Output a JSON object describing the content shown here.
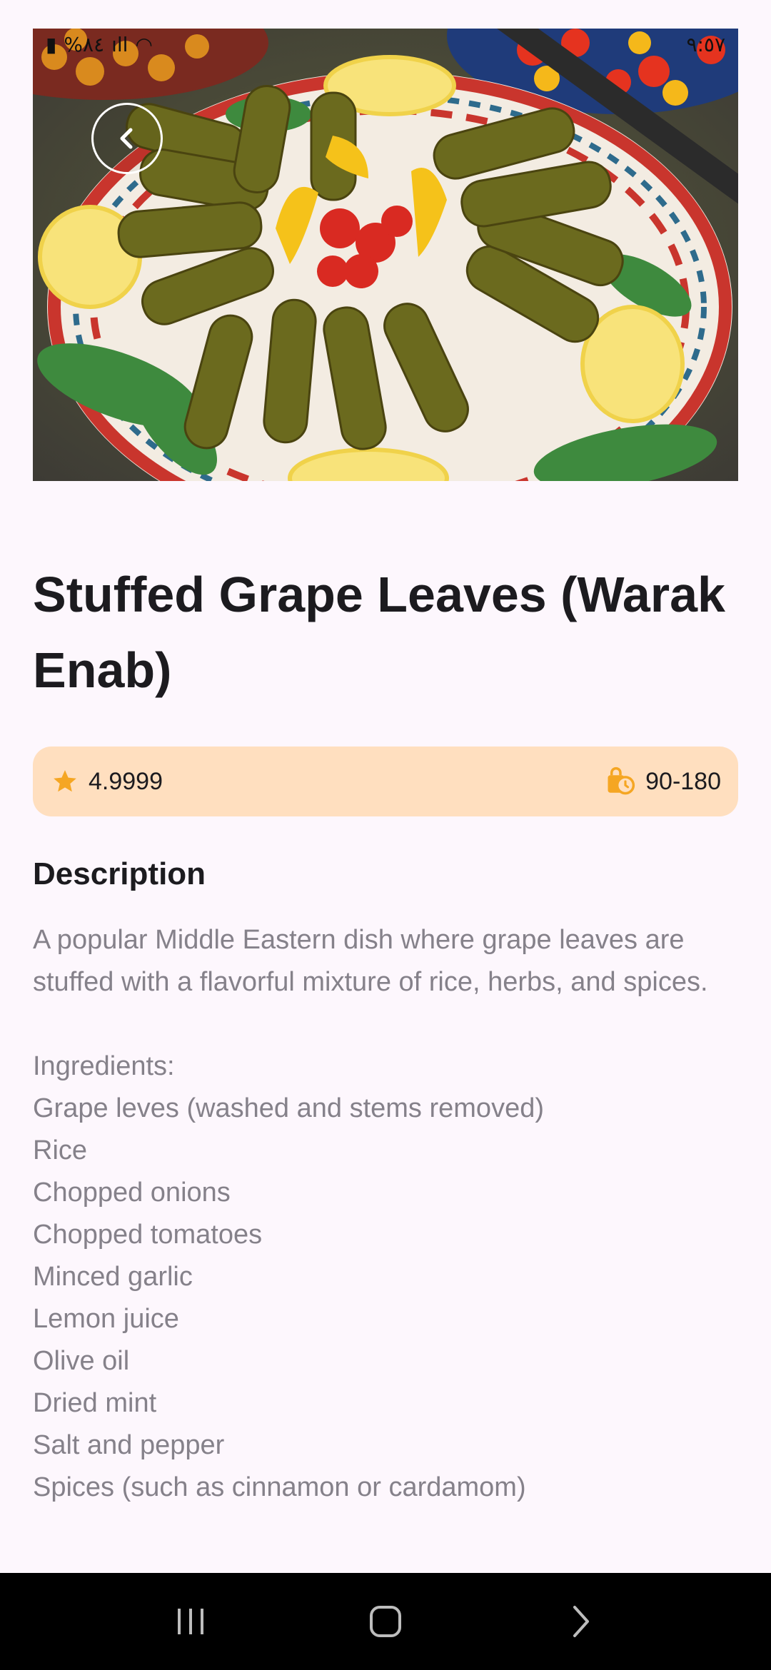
{
  "status_bar": {
    "left_text": "%٨٤",
    "right_text": "٩:٥٧"
  },
  "hero": {
    "image_alt": "Stuffed grape leaves platter",
    "back_icon": "chevron-left-icon"
  },
  "recipe": {
    "title": "Stuffed Grape Leaves (Warak Enab)",
    "rating": "4.9999",
    "time": "90-180",
    "description_heading": "Description",
    "description": "A popular Middle Eastern dish where grape leaves are stuffed with a flavorful mixture of rice, herbs, and spices.",
    "ingredients_heading": "Ingredients:",
    "ingredients": [
      "Grape leves (washed and stems removed)",
      "Rice",
      "Chopped onions",
      "Chopped tomatoes",
      "Minced garlic",
      "Lemon juice",
      "Olive oil",
      "Dried mint",
      "Salt and pepper",
      "Spices (such as cinnamon or cardamom)"
    ]
  },
  "colors": {
    "info_bar_bg": "#ffdfbf",
    "accent_orange": "#f5a623",
    "text_dark": "#1c1b1f",
    "text_muted": "#85818a"
  },
  "nav_bar": {
    "recent_icon": "recent-apps-icon",
    "home_icon": "home-icon",
    "back_icon": "back-icon"
  }
}
